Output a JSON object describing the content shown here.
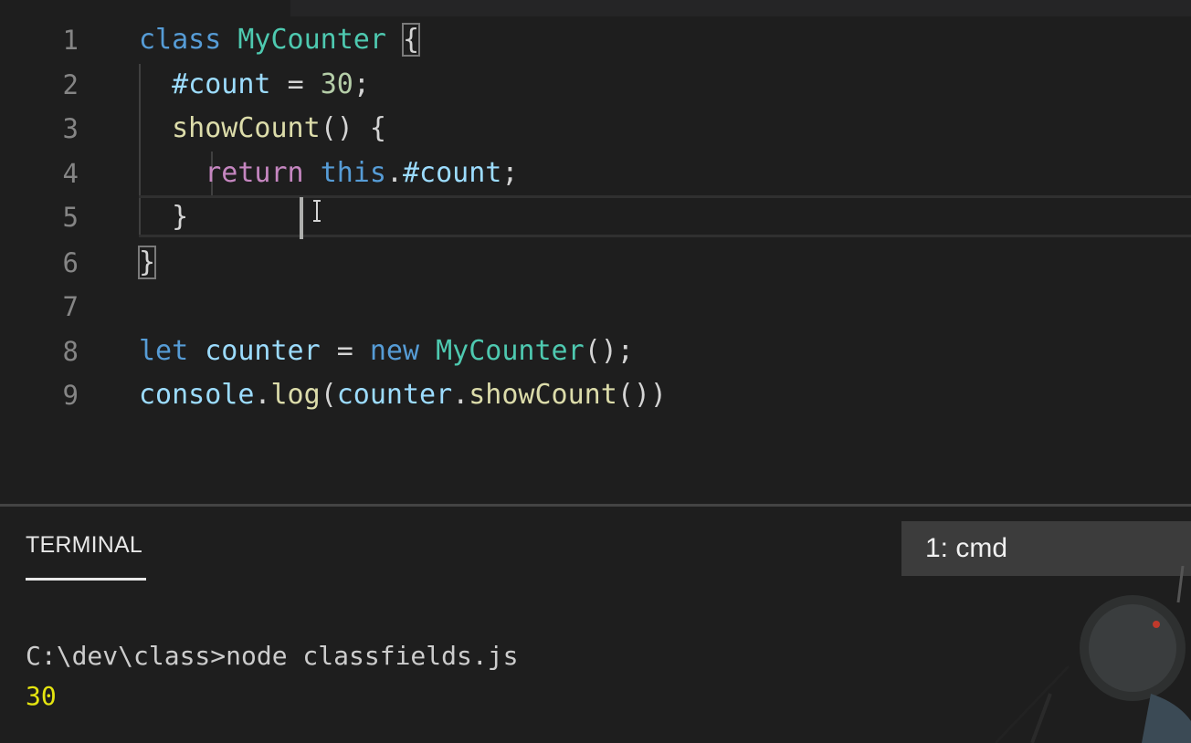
{
  "editor": {
    "line_numbers": [
      "1",
      "2",
      "3",
      "4",
      "5",
      "6",
      "7",
      "8",
      "9"
    ],
    "lines": {
      "l1": {
        "kw": "class",
        "cls": "MyCounter",
        "brace": "{"
      },
      "l2": {
        "field": "#count",
        "eq": "=",
        "num": "30",
        "semi": ";"
      },
      "l3": {
        "fn": "showCount",
        "parens": "()",
        "brace": "{"
      },
      "l4": {
        "ret": "return",
        "this": "this",
        "dot": ".",
        "field": "#count",
        "semi": ";"
      },
      "l5": {
        "brace": "}"
      },
      "l6": {
        "brace": "}"
      },
      "l8": {
        "kw": "let",
        "var": "counter",
        "eq": "=",
        "new": "new",
        "cls": "MyCounter",
        "tail": "();"
      },
      "l9": {
        "obj": "console",
        "dot1": ".",
        "fn": "log",
        "open": "(",
        "var": "counter",
        "dot2": ".",
        "fn2": "showCount",
        "tail": "())"
      }
    },
    "theme": {
      "background": "#1e1e1e",
      "keyword": "#569cd6",
      "control": "#c586c0",
      "class": "#4ec9b0",
      "function": "#dcdcaa",
      "variable": "#9cdcfe",
      "number": "#b5cea8"
    }
  },
  "panel": {
    "tab_label": "TERMINAL",
    "dropdown_value": "1: cmd",
    "terminal_lines": {
      "prompt": "C:\\dev\\class>node classfields.js",
      "output": "30"
    }
  },
  "icons": [
    "ibeam-cursor-icon"
  ]
}
